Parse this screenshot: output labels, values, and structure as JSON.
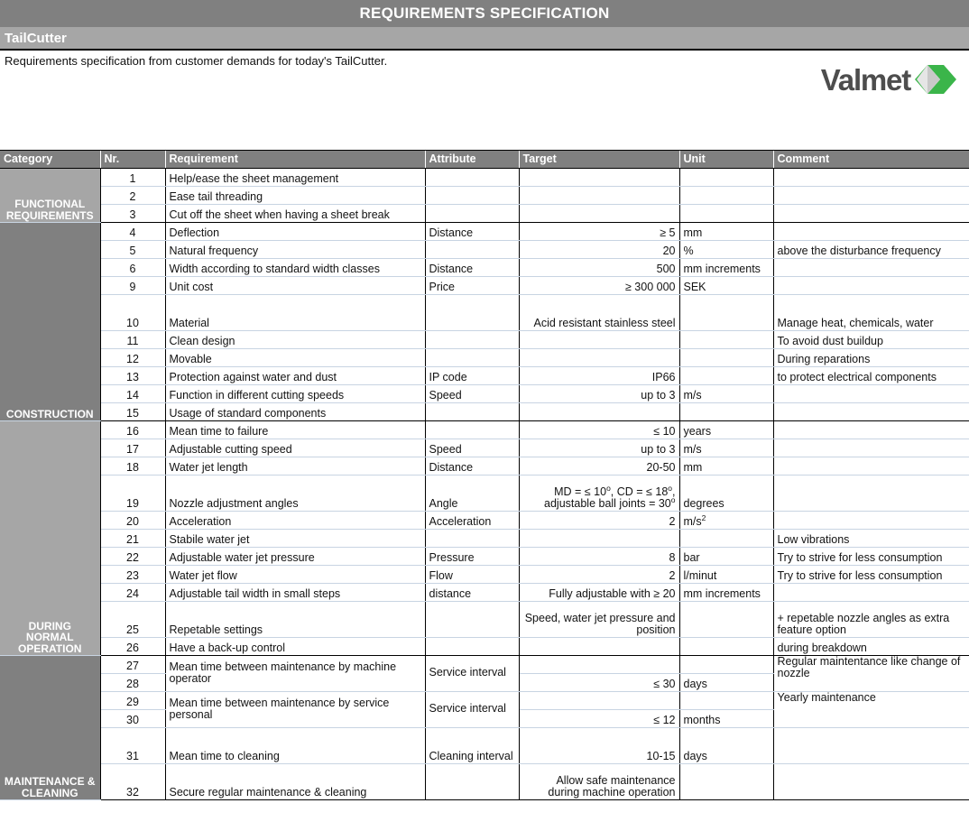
{
  "document": {
    "title": "REQUIREMENTS SPECIFICATION",
    "subject": "TailCutter",
    "intro": "Requirements specification from customer demands for today's TailCutter.",
    "logo_text": "Valmet",
    "logo_green": "#3bb54a",
    "logo_gray": "#4d4d4d",
    "header_bg": "#808080",
    "subject_bg": "#a6a6a6"
  },
  "table": {
    "columns": [
      "Category",
      "Nr.",
      "Requirement",
      "Attribute",
      "Target",
      "Unit",
      "Comment"
    ],
    "sections": [
      {
        "category": "FUNCTIONAL REQUIREMENTS",
        "shade": "light",
        "rows": [
          {
            "nr": "1",
            "requirement": "Help/ease the sheet management",
            "attribute": "",
            "target": "",
            "unit": "",
            "comment": ""
          },
          {
            "nr": "2",
            "requirement": "Ease tail threading",
            "attribute": "",
            "target": "",
            "unit": "",
            "comment": ""
          },
          {
            "nr": "3",
            "requirement": "Cut off the sheet when having a sheet break",
            "attribute": "",
            "target": "",
            "unit": "",
            "comment": ""
          }
        ]
      },
      {
        "category": "CONSTRUCTION",
        "shade": "dark",
        "rows": [
          {
            "nr": "4",
            "requirement": "Deflection",
            "attribute": "Distance",
            "target": "≥ 5",
            "unit": "mm",
            "comment": ""
          },
          {
            "nr": "5",
            "requirement": "Natural frequency",
            "attribute": "",
            "target": "20",
            "unit": "%",
            "comment": "above the disturbance frequency"
          },
          {
            "nr": "6",
            "requirement": "Width according to standard width classes",
            "attribute": "Distance",
            "target": "500",
            "unit": "mm increments",
            "comment": ""
          },
          {
            "nr": "9",
            "requirement": "Unit cost",
            "attribute": "Price",
            "target": "≥ 300 000",
            "unit": "SEK",
            "comment": ""
          },
          {
            "nr": "10",
            "requirement": "Material",
            "attribute": "",
            "target": "Acid resistant stainless steel",
            "unit": "",
            "comment": "Manage heat, chemicals, water",
            "tall": true
          },
          {
            "nr": "11",
            "requirement": "Clean design",
            "attribute": "",
            "target": "",
            "unit": "",
            "comment": "To avoid dust buildup"
          },
          {
            "nr": "12",
            "requirement": "Movable",
            "attribute": "",
            "target": "",
            "unit": "",
            "comment": "During reparations"
          },
          {
            "nr": "13",
            "requirement": "Protection against water and dust",
            "attribute": "IP code",
            "target": "IP66",
            "unit": "",
            "comment": "to protect electrical components"
          },
          {
            "nr": "14",
            "requirement": "Function in different cutting speeds",
            "attribute": "Speed",
            "target": "up to 3",
            "unit": "m/s",
            "comment": ""
          },
          {
            "nr": "15",
            "requirement": "Usage of standard components",
            "attribute": "",
            "target": "",
            "unit": "",
            "comment": ""
          }
        ]
      },
      {
        "category": "DURING NORMAL OPERATION",
        "shade": "light",
        "rows": [
          {
            "nr": "16",
            "requirement": "Mean time to failure",
            "attribute": "",
            "target": "≤ 10",
            "unit": "years",
            "comment": ""
          },
          {
            "nr": "17",
            "requirement": "Adjustable cutting speed",
            "attribute": "Speed",
            "target": "up to 3",
            "unit": "m/s",
            "comment": ""
          },
          {
            "nr": "18",
            "requirement": "Water jet length",
            "attribute": "Distance",
            "target": "20-50",
            "unit": "mm",
            "comment": ""
          },
          {
            "nr": "19",
            "requirement": "Nozzle adjustment angles",
            "attribute": "Angle",
            "target": "MD = ≤ 10º, CD = ≤ 18º, adjustable ball joints = 30º",
            "unit": "degrees",
            "comment": "",
            "tall": true
          },
          {
            "nr": "20",
            "requirement": "Acceleration",
            "attribute": "Acceleration",
            "target": "2",
            "unit": "m/s2",
            "comment": ""
          },
          {
            "nr": "21",
            "requirement": "Stabile water jet",
            "attribute": "",
            "target": "",
            "unit": "",
            "comment": "Low vibrations"
          },
          {
            "nr": "22",
            "requirement": "Adjustable water jet pressure",
            "attribute": "Pressure",
            "target": "8",
            "unit": "bar",
            "comment": "Try to strive for less consumption"
          },
          {
            "nr": "23",
            "requirement": "Water jet flow",
            "attribute": "Flow",
            "target": "2",
            "unit": "l/minut",
            "comment": "Try to strive for less consumption"
          },
          {
            "nr": "24",
            "requirement": "Adjustable tail width in small steps",
            "attribute": "distance",
            "target": "Fully adjustable with ≥ 20",
            "unit": "mm increments",
            "comment": ""
          },
          {
            "nr": "25",
            "requirement": "Repetable settings",
            "attribute": "",
            "target": "Speed, water jet pressure and position",
            "unit": "",
            "comment": "+ repetable nozzle angles as extra feature option",
            "tall": true
          },
          {
            "nr": "26",
            "requirement": "Have a back-up control",
            "attribute": "",
            "target": "",
            "unit": "",
            "comment": "during breakdown"
          }
        ]
      },
      {
        "category": "MAINTENANCE & CLEANING",
        "shade": "dark",
        "rows": [
          {
            "nr": "27",
            "requirement": "Mean time between maintenance by machine operator",
            "attribute": "Service interval",
            "target": "",
            "unit": "",
            "comment": "Regular maintentance like change of nozzle",
            "merge": 2
          },
          {
            "nr": "28",
            "target": "≤ 30",
            "unit": "days"
          },
          {
            "nr": "29",
            "requirement": "Mean time between maintenance by service personal",
            "attribute": "Service interval",
            "target": "",
            "unit": "",
            "comment": "Yearly maintenance",
            "merge": 2
          },
          {
            "nr": "30",
            "target": "≤ 12",
            "unit": "months"
          },
          {
            "nr": "31",
            "requirement": "Mean time to cleaning",
            "attribute": "Cleaning interval",
            "target": "10-15",
            "unit": "days",
            "comment": "",
            "tall": true
          },
          {
            "nr": "32",
            "requirement": "Secure regular maintenance & cleaning",
            "attribute": "",
            "target": "Allow safe maintenance during machine operation",
            "unit": "",
            "comment": "",
            "tall": true
          }
        ]
      }
    ]
  }
}
